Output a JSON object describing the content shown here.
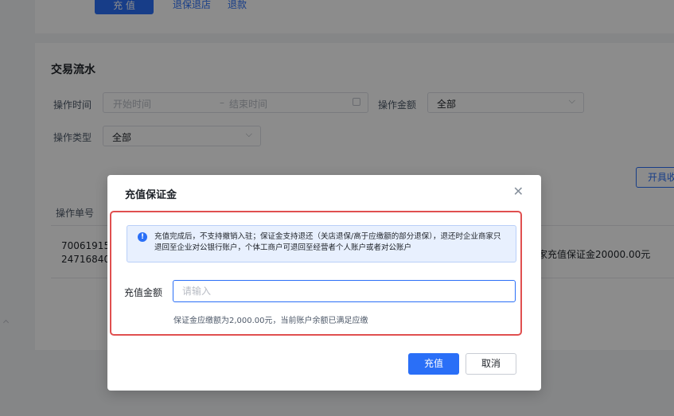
{
  "top_actions": {
    "recharge_label": "充 值",
    "refund_shop_label": "退保退店",
    "refund_label": "退款"
  },
  "flow": {
    "title": "交易流水",
    "op_time_label": "操作时间",
    "start_placeholder": "开始时间",
    "range_sep": "–",
    "end_placeholder": "结束时间",
    "op_amount_label": "操作金额",
    "op_amount_value": "全部",
    "op_type_label": "操作类型",
    "op_type_value": "全部",
    "invoice_button": "开具收",
    "col_order_no": "操作单号",
    "row_order_line1": "70061915",
    "row_order_line2": "24716840",
    "row_desc": "家充值保证金20000.00元"
  },
  "modal": {
    "title": "充值保证金",
    "alert_text": "充值完成后，不支持撤销入驻；保证金支持退还（关店退保/高于应缴额的部分退保），退还时企业商家只退回至企业对公银行账户，个体工商户可退回至经营者个人账户或者对公账户",
    "amount_label": "充值金额",
    "amount_placeholder": "请输入",
    "amount_value": "",
    "hint": "保证金应缴额为2,000.00元，当前账户余额已满足应缴",
    "confirm_label": "充值",
    "cancel_label": "取消"
  },
  "icons": {
    "close": "close-icon",
    "info": "info-icon",
    "chevron": "chevron-down-icon",
    "calendar": "calendar-icon"
  },
  "colors": {
    "primary": "#2a6ff7",
    "highlight_border": "#e04f4f",
    "alert_bg": "#e8f0fe"
  }
}
